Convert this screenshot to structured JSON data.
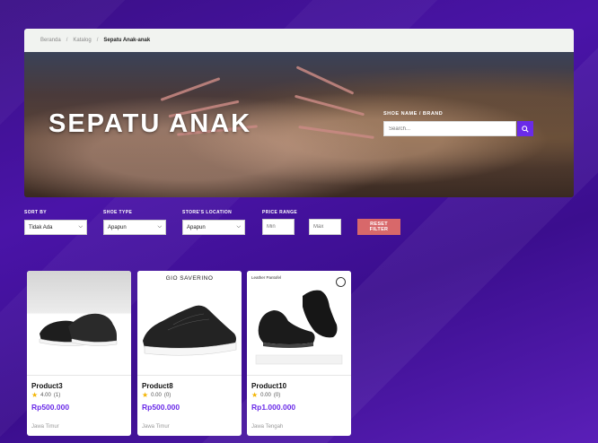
{
  "breadcrumb": {
    "items": [
      "Beranda",
      "Katalog",
      "Sepatu Anak-anak"
    ]
  },
  "hero": {
    "title": "SEPATU ANAK",
    "search_label": "SHOE NAME / BRAND",
    "search_placeholder": "Search...",
    "search_icon": "search-icon"
  },
  "filters": {
    "sort_label": "SORT BY",
    "sort_value": "Tidak Ada",
    "type_label": "SHOE TYPE",
    "type_value": "Apapun",
    "location_label": "STORE'S LOCATION",
    "location_value": "Apapun",
    "price_label": "PRICE RANGE",
    "price_min_placeholder": "Min",
    "price_max_placeholder": "Max",
    "reset_label": "RESET FILTER"
  },
  "products": [
    {
      "name": "Product3",
      "rating": "4.00",
      "reviews": "(1)",
      "price": "Rp500.000",
      "location": "Jawa Timur",
      "caption": ""
    },
    {
      "name": "Product8",
      "rating": "0.00",
      "reviews": "(0)",
      "price": "Rp500.000",
      "location": "Jawa Timur",
      "caption": "GIO SAVERINO"
    },
    {
      "name": "Product10",
      "rating": "0.00",
      "reviews": "(0)",
      "price": "Rp1.000.000",
      "location": "Jawa Tengah",
      "caption": "Leather Pantofel"
    }
  ],
  "colors": {
    "accent": "#6a2be8",
    "reset": "#d8686a",
    "star": "#f3b400"
  }
}
